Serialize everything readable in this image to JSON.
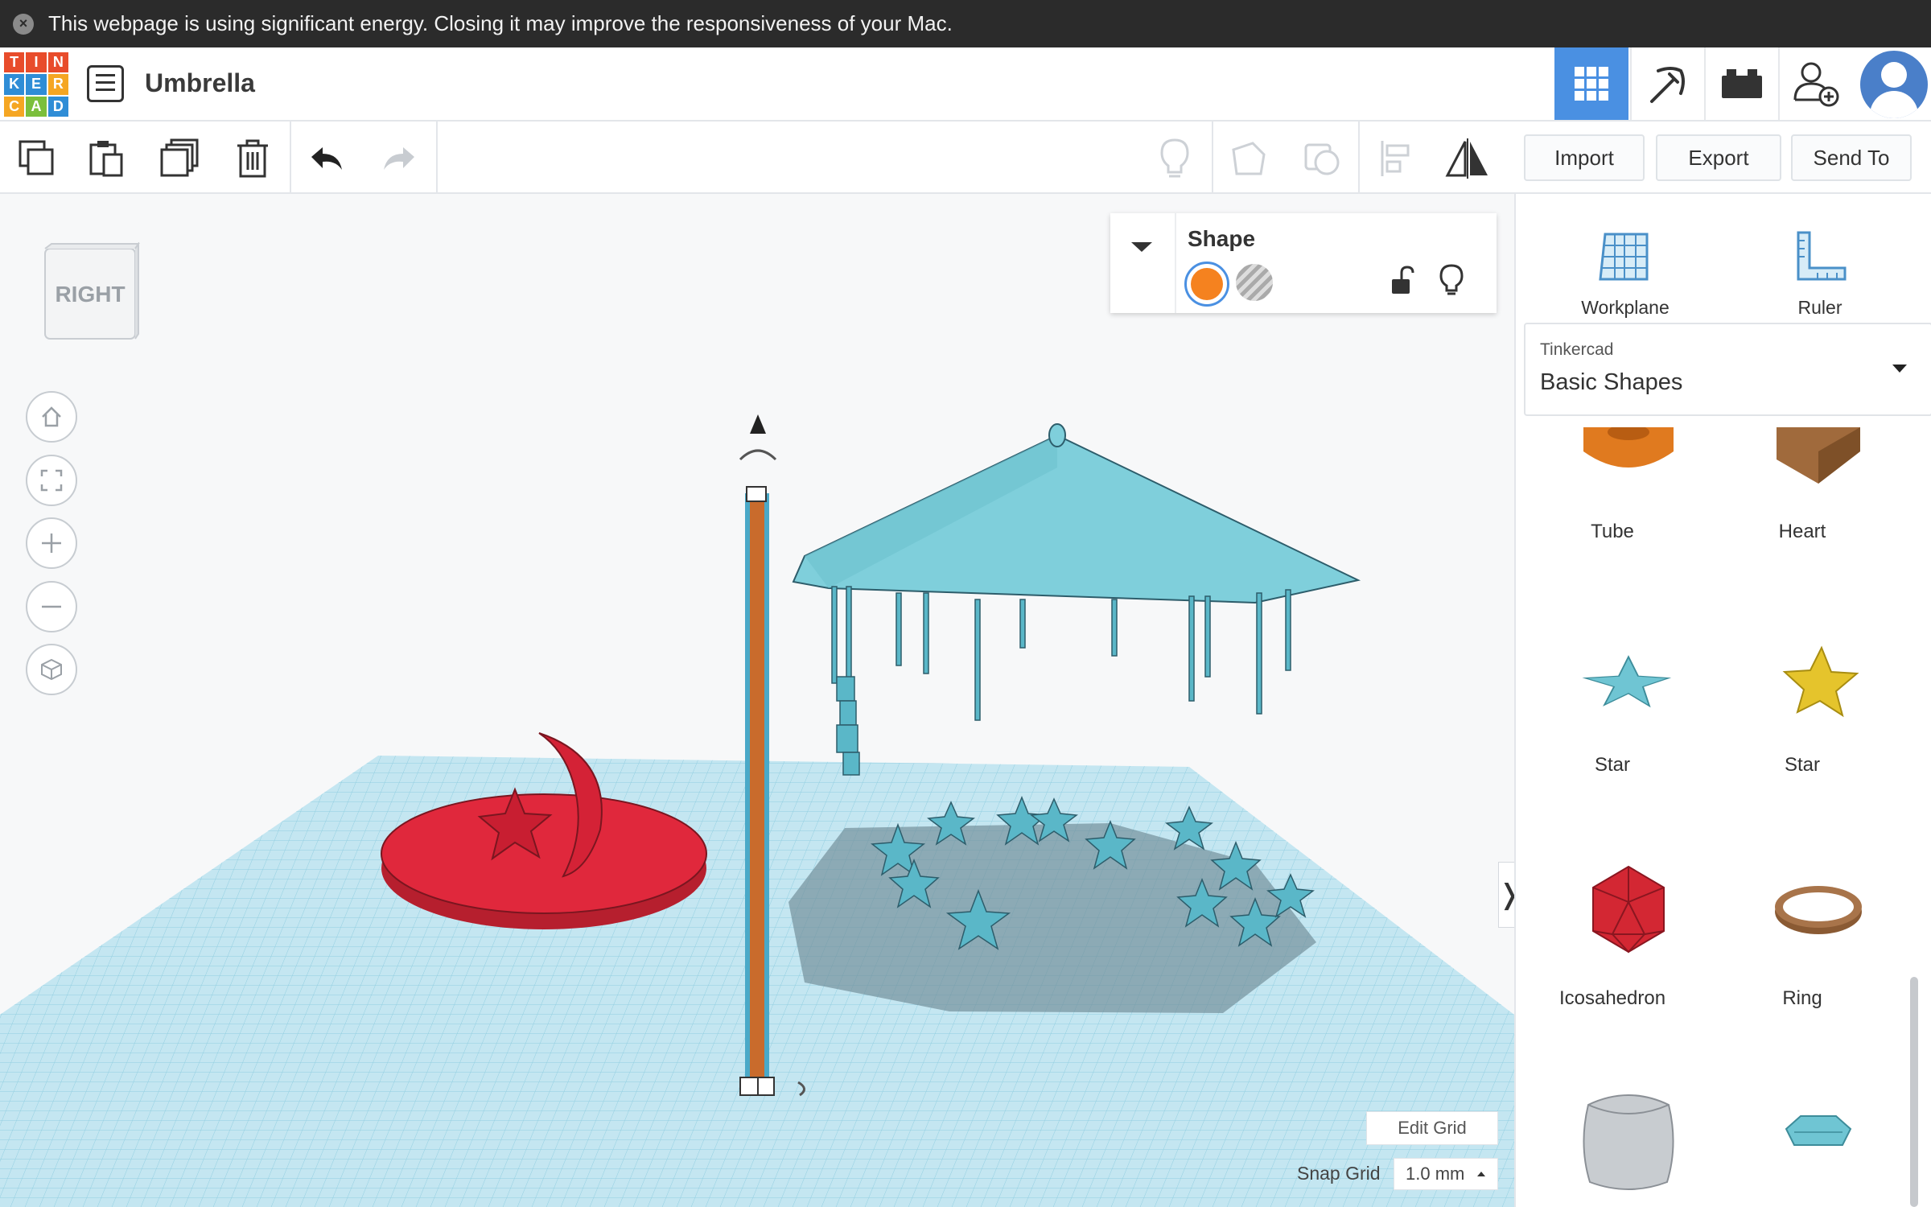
{
  "banner": {
    "message": "This webpage is using significant energy. Closing it may improve the responsiveness of your Mac."
  },
  "header": {
    "logo_letters": [
      "T",
      "I",
      "N",
      "K",
      "E",
      "R",
      "C",
      "A",
      "D"
    ],
    "logo_colors": [
      "#e84c2b",
      "#e84c2b",
      "#e84c2b",
      "#2f8dd6",
      "#2f8dd6",
      "#f5a623",
      "#f5a623",
      "#7bbf3b",
      "#2f8dd6"
    ],
    "design_title": "Umbrella",
    "accent_color": "#4a90e2"
  },
  "toolbar": {
    "import_label": "Import",
    "export_label": "Export",
    "send_to_label": "Send To"
  },
  "viewcube": {
    "face_label": "RIGHT"
  },
  "shape_panel": {
    "title": "Shape",
    "solid_color": "#f5821f"
  },
  "grid": {
    "edit_grid_label": "Edit Grid",
    "snap_grid_label": "Snap Grid",
    "snap_grid_value": "1.0 mm"
  },
  "right_panel": {
    "workplane_label": "Workplane",
    "ruler_label": "Ruler",
    "library_provider": "Tinkercad",
    "library_name": "Basic Shapes",
    "shapes": [
      {
        "label": "Tube",
        "icon": "tube-icon"
      },
      {
        "label": "Heart",
        "icon": "heart-icon"
      },
      {
        "label": "Star",
        "icon": "star-icon"
      },
      {
        "label": "Star",
        "icon": "star-icon"
      },
      {
        "label": "Icosahedron",
        "icon": "icosahedron-icon"
      },
      {
        "label": "Ring",
        "icon": "ring-icon"
      }
    ]
  },
  "scene_colors": {
    "grid": "#bfe3f0",
    "umbrella": "#72c7d4",
    "base": "#e0283c",
    "pole": "#c96b2c"
  }
}
